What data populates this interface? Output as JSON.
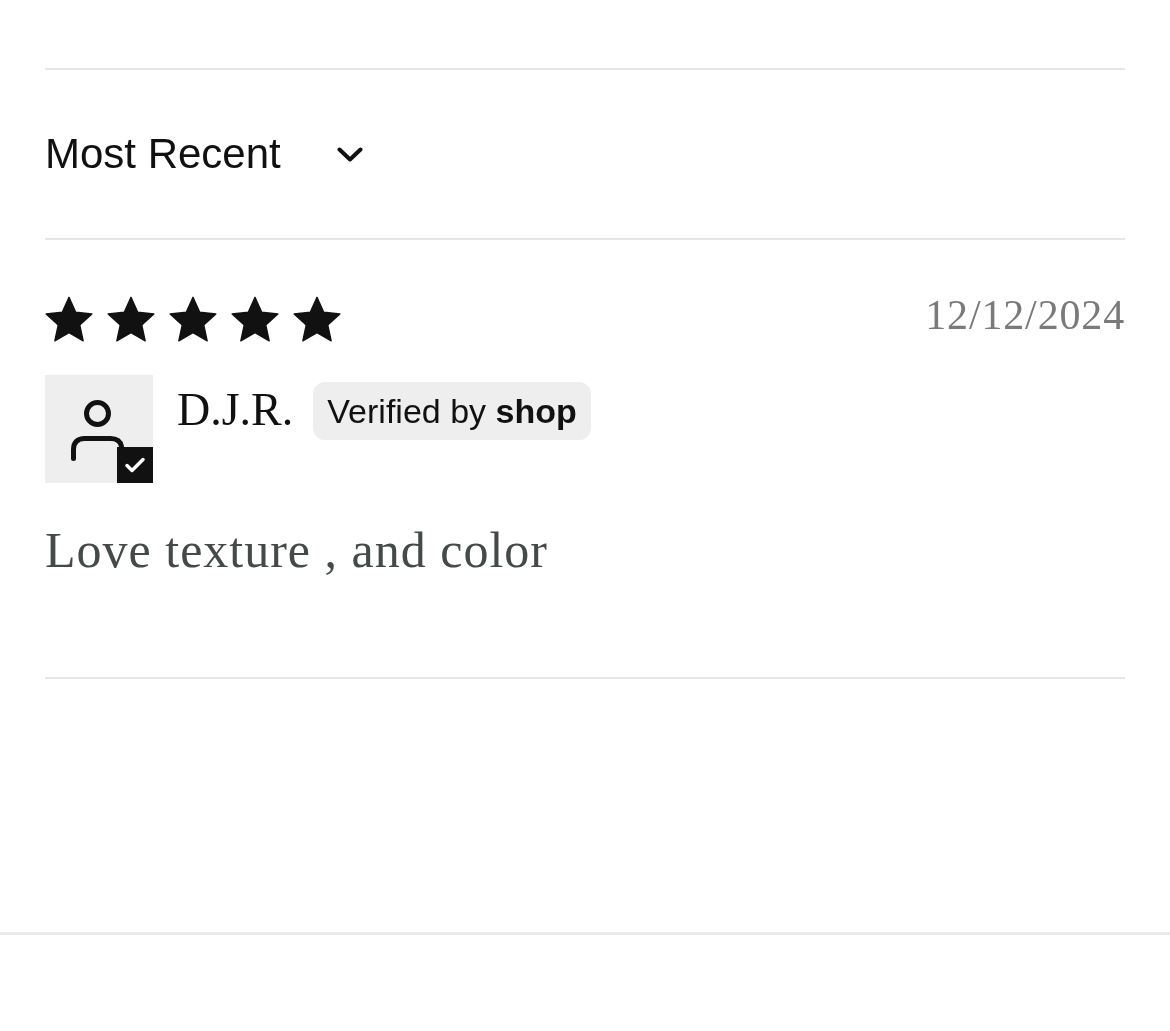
{
  "sort": {
    "label": "Most Recent"
  },
  "reviews": [
    {
      "stars": 5,
      "date": "12/12/2024",
      "author": "D.J.R.",
      "verified": true,
      "badge": "Verified by **shop**",
      "body": "Love texture , and color"
    }
  ]
}
